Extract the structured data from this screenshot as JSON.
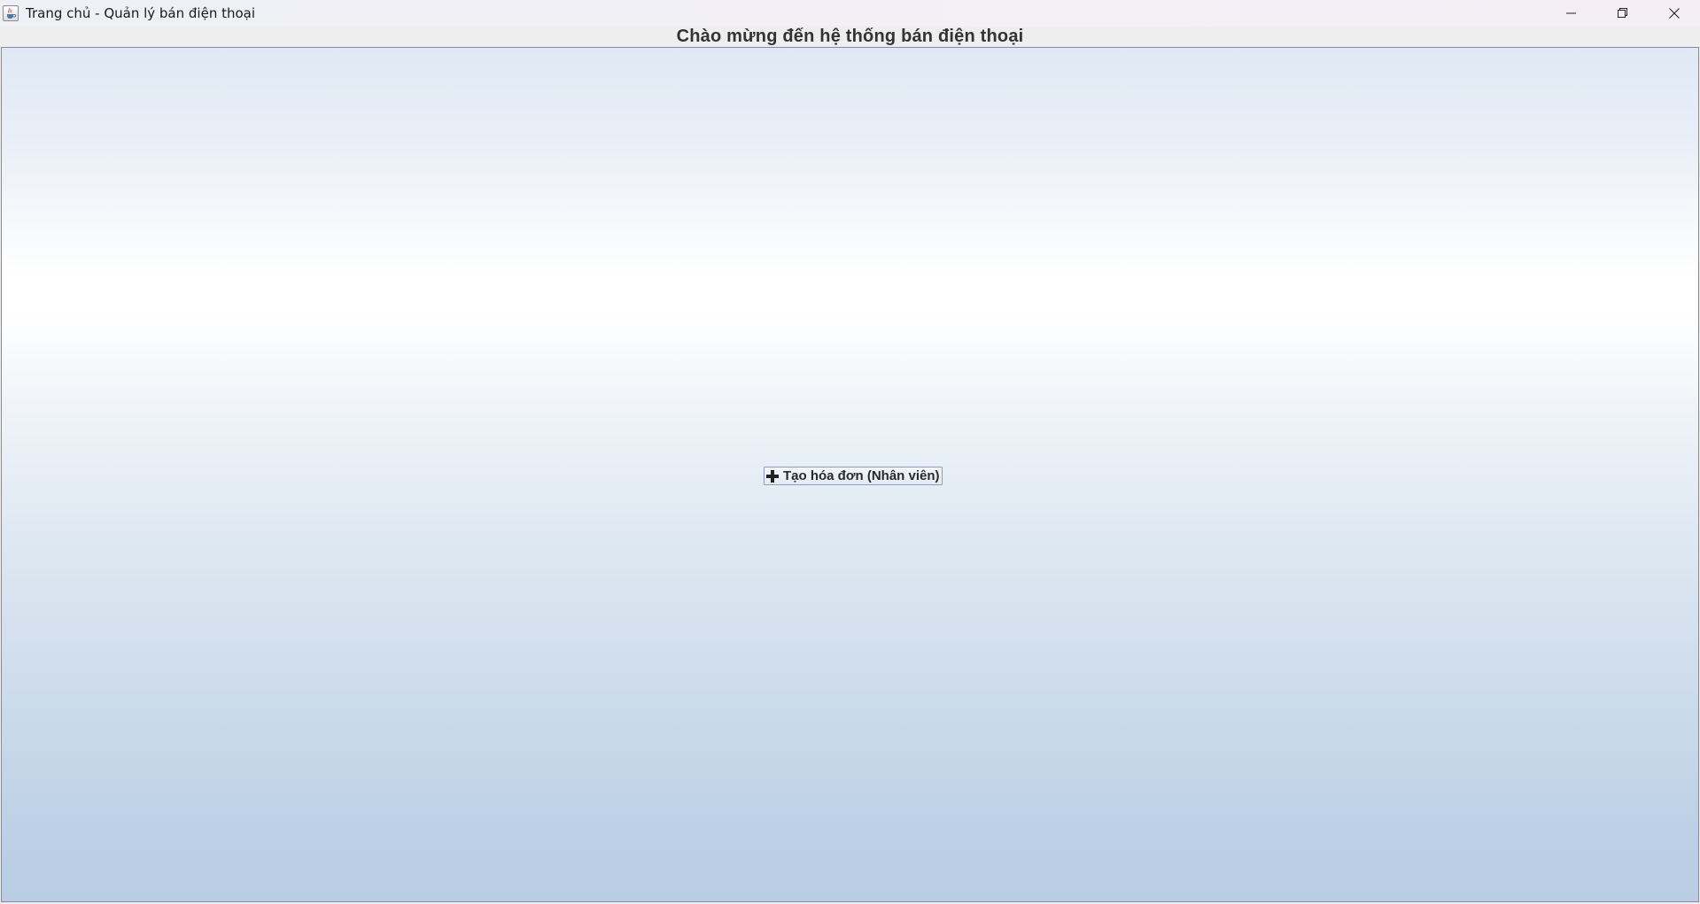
{
  "window": {
    "title": "Trang chủ - Quản lý bán điện thoại",
    "app_icon": "java-cup-icon",
    "controls": {
      "minimize_icon": "minimize-icon",
      "restore_icon": "restore-icon",
      "close_icon": "close-icon"
    }
  },
  "header": {
    "welcome_title": "Chào mừng đến hệ thống bán điện thoại"
  },
  "main": {
    "create_invoice_button": {
      "icon": "plus-icon",
      "label": "Tạo hóa đơn (Nhân viên)"
    }
  },
  "colors": {
    "panel_gradient_top": "#e0e9f3",
    "panel_gradient_mid": "#ffffff",
    "panel_gradient_bottom": "#b9cde4",
    "title_text": "#333333"
  }
}
